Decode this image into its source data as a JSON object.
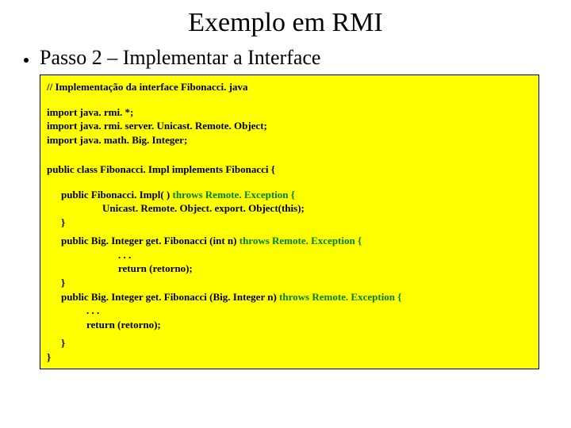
{
  "title": "Exemplo em RMI",
  "subtitle": "Passo 2 – Implementar a Interface",
  "code": {
    "comment": "// Implementação da interface Fibonacci. java",
    "import1": "import java. rmi. *;",
    "import2": "import java. rmi. server. Unicast. Remote. Object;",
    "import3": "import java. math. Big. Integer;",
    "classdecl": "public class Fibonacci. Impl implements Fibonacci {",
    "ctor_a": "public Fibonacci. Impl( ) ",
    "ctor_b": "throws Remote. Exception {",
    "ctor_body": "Unicast. Remote. Object. export. Object(this);",
    "brace": "}",
    "m1_a": "public Big. Integer get. Fibonacci (int n) ",
    "m1_b": "throws Remote. Exception {",
    "dots": ". . .",
    "ret": "return (retorno);",
    "m2_a": "public Big. Integer get. Fibonacci (Big. Integer n) ",
    "m2_b": "throws Remote. Exception {"
  }
}
